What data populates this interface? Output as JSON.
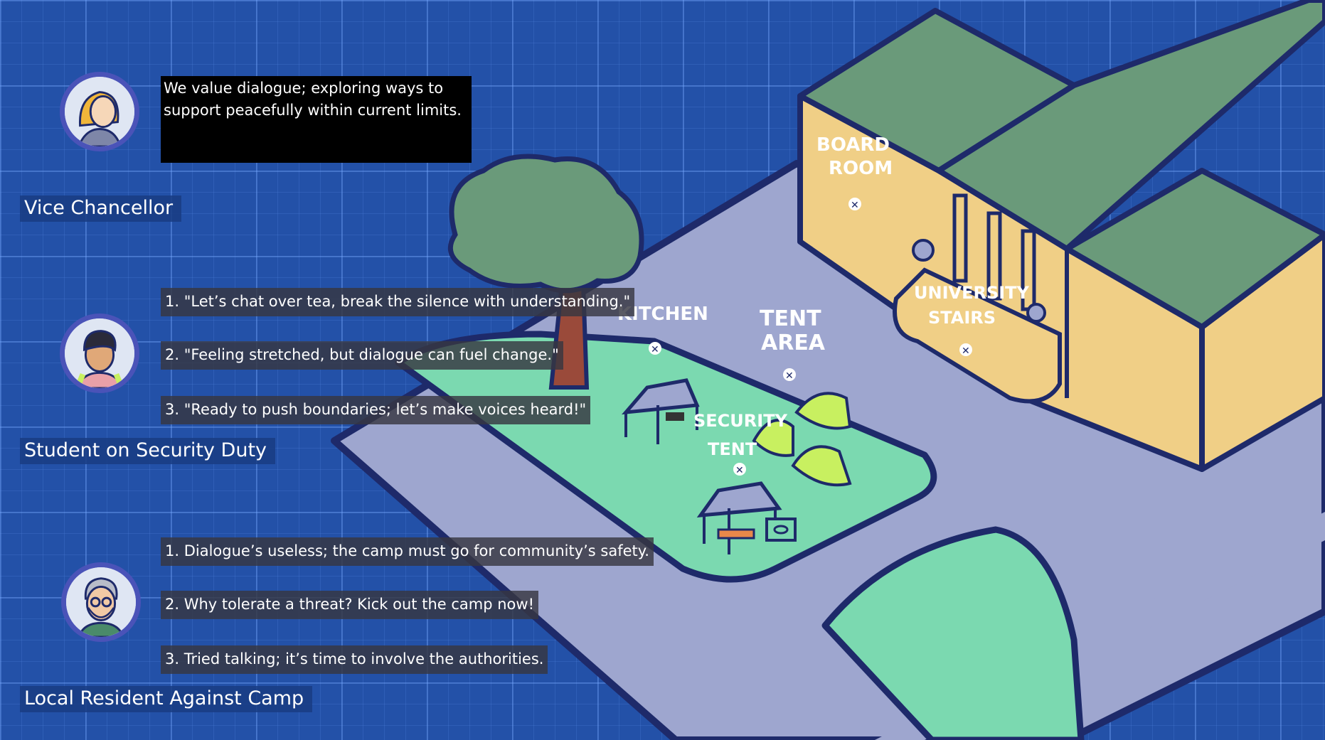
{
  "npcs": [
    {
      "name": "Vice Chancellor",
      "speech": "We value dialogue; exploring ways to support peacefully within current limits.",
      "avatar_icon": "vice-chancellor-portrait-icon"
    },
    {
      "name": "Student on Security Duty",
      "avatar_icon": "student-portrait-icon",
      "options": [
        "1. \"Let’s chat over tea, break the silence with understanding.\"",
        "2. \"Feeling stretched, but dialogue can fuel change.\"",
        "3. \"Ready to push boundaries; let’s make voices heard!\""
      ]
    },
    {
      "name": "Local Resident Against Camp",
      "avatar_icon": "local-resident-portrait-icon",
      "options": [
        "1. Dialogue’s useless; the camp must go for community’s safety.",
        "2. Why tolerate a threat? Kick out the camp now!",
        "3. Tried talking; it’s time to involve the authorities."
      ]
    }
  ],
  "map": {
    "locations": {
      "board_room": [
        "BOARD",
        "ROOM"
      ],
      "kitchen": [
        "KITCHEN"
      ],
      "tent_area": [
        "TENT",
        "AREA"
      ],
      "security_tent": [
        "SECURITY",
        "TENT"
      ],
      "university_stairs": [
        "UNIVERSITY",
        "STAIRS"
      ]
    }
  },
  "colors": {
    "background": "#2351a8",
    "road": "#9ea6cf",
    "lawn": "#7bd9b0",
    "building_wall": "#f0cf86",
    "roof": "#6a9a7a",
    "outline": "#1e2a6a",
    "tent": "#c8f060",
    "avatar_ring": "#4a53b8"
  }
}
